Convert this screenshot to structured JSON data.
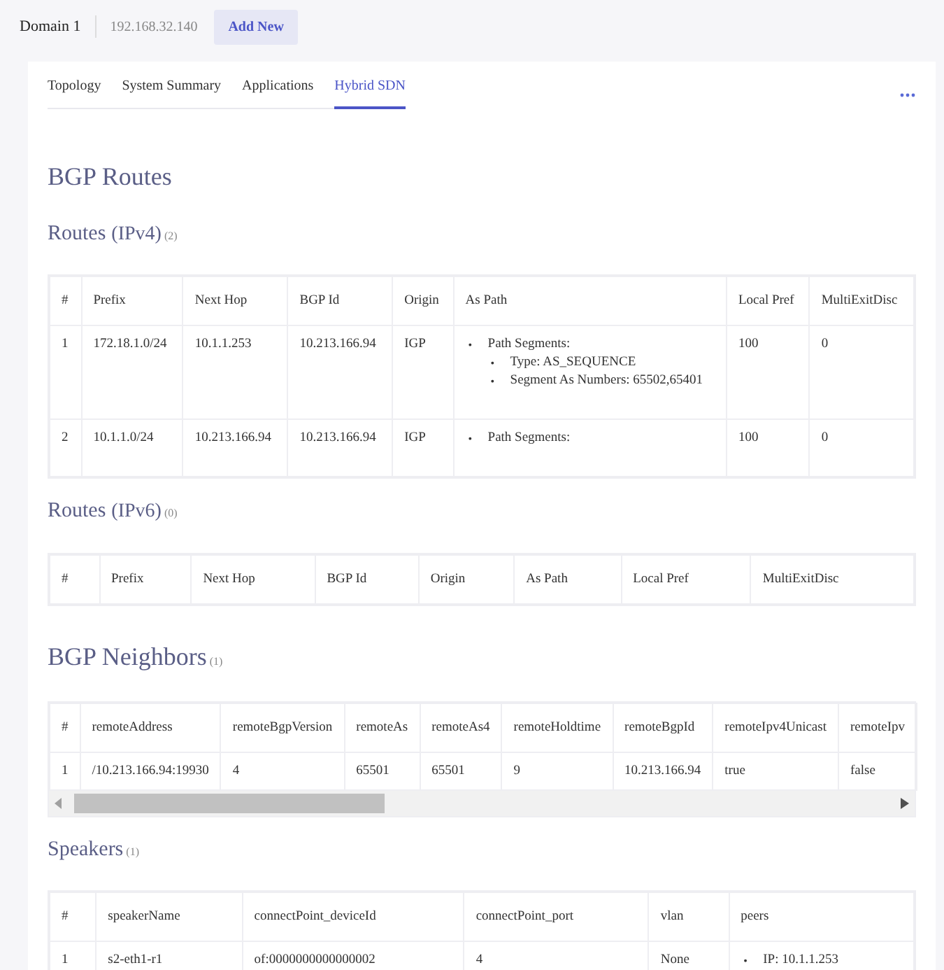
{
  "header": {
    "domain": "Domain 1",
    "address": "192.168.32.140",
    "add_button": "Add New"
  },
  "tabs": [
    {
      "label": "Topology",
      "selected": false
    },
    {
      "label": "System Summary",
      "selected": false
    },
    {
      "label": "Applications",
      "selected": false
    },
    {
      "label": "Hybrid SDN",
      "selected": true
    }
  ],
  "sections": [
    {
      "kind": "major",
      "title": "BGP Routes"
    },
    {
      "kind": "minor",
      "title": "Routes",
      "qualifier": "(IPv4)",
      "count": "(2)",
      "table": {
        "columns": [
          "#",
          "Prefix",
          "Next Hop",
          "BGP Id",
          "Origin",
          "As Path",
          "Local Pref",
          "MultiExitDisc"
        ],
        "rows": [
          [
            "1",
            "172.18.1.0/24",
            "10.1.1.253",
            "10.213.166.94",
            "IGP",
            {
              "list": [
                {
                  "marker": "•",
                  "text": "Path Segments:",
                  "children": [
                    {
                      "marker": "•",
                      "text": "Type: AS_SEQUENCE"
                    },
                    {
                      "marker": "•",
                      "text": "Segment As Numbers: 65502,65401"
                    }
                  ]
                }
              ]
            },
            "100",
            "0"
          ],
          [
            "2",
            "10.1.1.0/24",
            "10.213.166.94",
            "10.213.166.94",
            "IGP",
            {
              "list": [
                {
                  "marker": "•",
                  "text": "Path Segments:"
                }
              ]
            },
            "100",
            "0"
          ]
        ]
      }
    },
    {
      "kind": "minor",
      "title": "Routes",
      "qualifier": "(IPv6)",
      "count": "(0)",
      "table": {
        "columns": [
          "#",
          "Prefix",
          "Next Hop",
          "BGP Id",
          "Origin",
          "As Path",
          "Local Pref",
          "MultiExitDisc"
        ]
      }
    },
    {
      "kind": "major",
      "title": "BGP Neighbors",
      "count": "(1)",
      "table": {
        "kind": "scrolling",
        "columns": [
          "#",
          "remoteAddress",
          "remoteBgpVersion",
          "remoteAs",
          "remoteAs4",
          "remoteHoldtime",
          "remoteBgpId",
          "remoteIpv4Unicast",
          "remoteIpv"
        ],
        "rows": [
          [
            "1",
            "/10.213.166.94:19930",
            "4",
            "65501",
            "65501",
            "9",
            "10.213.166.94",
            "true",
            "false"
          ]
        ]
      }
    },
    {
      "kind": "minor",
      "title": "Speakers",
      "count": "(1)",
      "table": {
        "columns": [
          "#",
          "speakerName",
          "connectPoint_deviceId",
          "connectPoint_port",
          "vlan",
          "peers"
        ],
        "rows": [
          [
            "1",
            "s2-eth1-r1",
            "of:0000000000000002",
            "4",
            "None",
            {
              "list": [
                {
                  "marker": "•",
                  "text": "IP: 10.1.1.253"
                }
              ]
            }
          ]
        ]
      }
    }
  ]
}
